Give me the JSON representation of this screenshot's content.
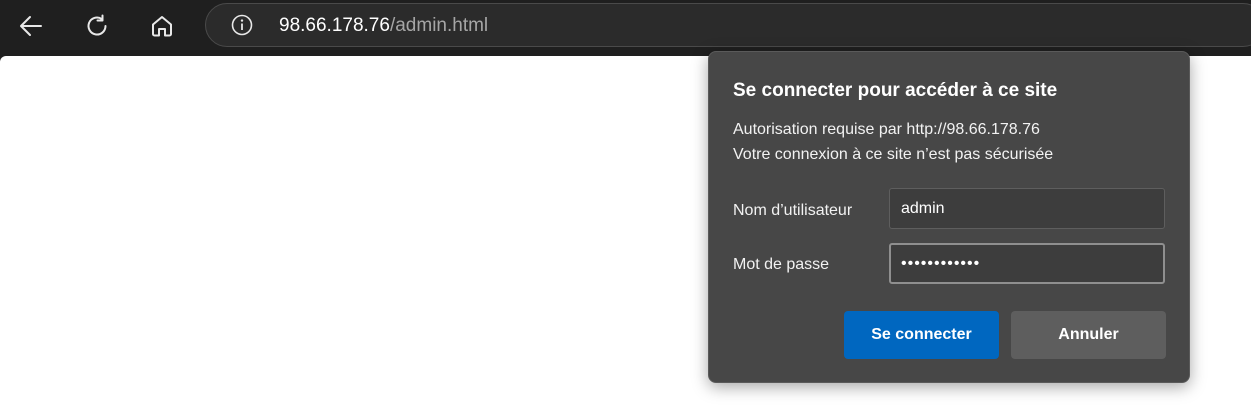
{
  "toolbar": {
    "back_icon": "back-arrow-icon",
    "refresh_icon": "refresh-icon",
    "home_icon": "home-icon"
  },
  "address_bar": {
    "security_icon": "info-icon",
    "host": "98.66.178.76",
    "path": "/admin.html"
  },
  "auth_dialog": {
    "title": "Se connecter pour accéder à ce site",
    "authorization_text": "Autorisation requise par http://98.66.178.76",
    "security_warning": "Votre connexion à ce site n’est pas sécurisée",
    "username_label": "Nom d’utilisateur",
    "username_value": "admin",
    "password_label": "Mot de passe",
    "password_value": "••••••••••••",
    "sign_in_label": "Se connecter",
    "cancel_label": "Annuler",
    "colors": {
      "primary_button": "#0067c0",
      "dialog_background": "#474747"
    }
  }
}
